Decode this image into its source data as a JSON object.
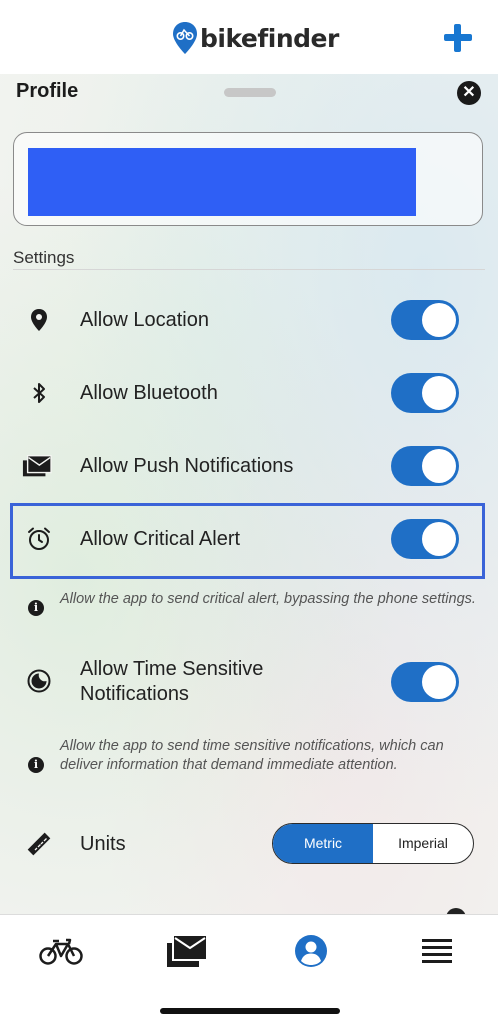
{
  "app": {
    "brand": "bikefinder",
    "accent_color": "#1f6fc6",
    "logo_icon": "location-pin-bike-icon"
  },
  "header": {
    "add_icon": "plus-icon"
  },
  "sheet": {
    "title": "Profile",
    "close_icon": "close-circle-icon",
    "close_glyph": "✕"
  },
  "profile_card": {
    "name_redacted": true
  },
  "settings": {
    "section_title": "Settings",
    "items": [
      {
        "label": "Allow Location",
        "icon": "location-pin-icon",
        "enabled": true
      },
      {
        "label": "Allow Bluetooth",
        "icon": "bluetooth-icon",
        "enabled": true
      },
      {
        "label": "Allow Push Notifications",
        "icon": "envelope-stack-icon",
        "enabled": true
      },
      {
        "label": "Allow Critical Alert",
        "icon": "alarm-clock-icon",
        "enabled": true,
        "highlighted": true,
        "info": "Allow the app to send critical alert, bypassing the phone settings."
      },
      {
        "label_line1": "Allow Time Sensitive",
        "label_line2": "Notifications",
        "icon": "moon-clock-icon",
        "enabled": true,
        "info": "Allow the app to send time sensitive notifications, which can deliver information that demand immediate attention."
      }
    ],
    "units": {
      "label": "Units",
      "icon": "ruler-icon",
      "options": [
        "Metric",
        "Imperial"
      ],
      "selected": "Metric"
    }
  },
  "info_glyph": "i",
  "tabbar": {
    "tabs": [
      {
        "name": "bike",
        "icon": "bicycle-icon"
      },
      {
        "name": "messages",
        "icon": "envelope-icon"
      },
      {
        "name": "profile",
        "icon": "user-circle-icon",
        "active": true
      },
      {
        "name": "menu",
        "icon": "hamburger-menu-icon"
      }
    ]
  }
}
